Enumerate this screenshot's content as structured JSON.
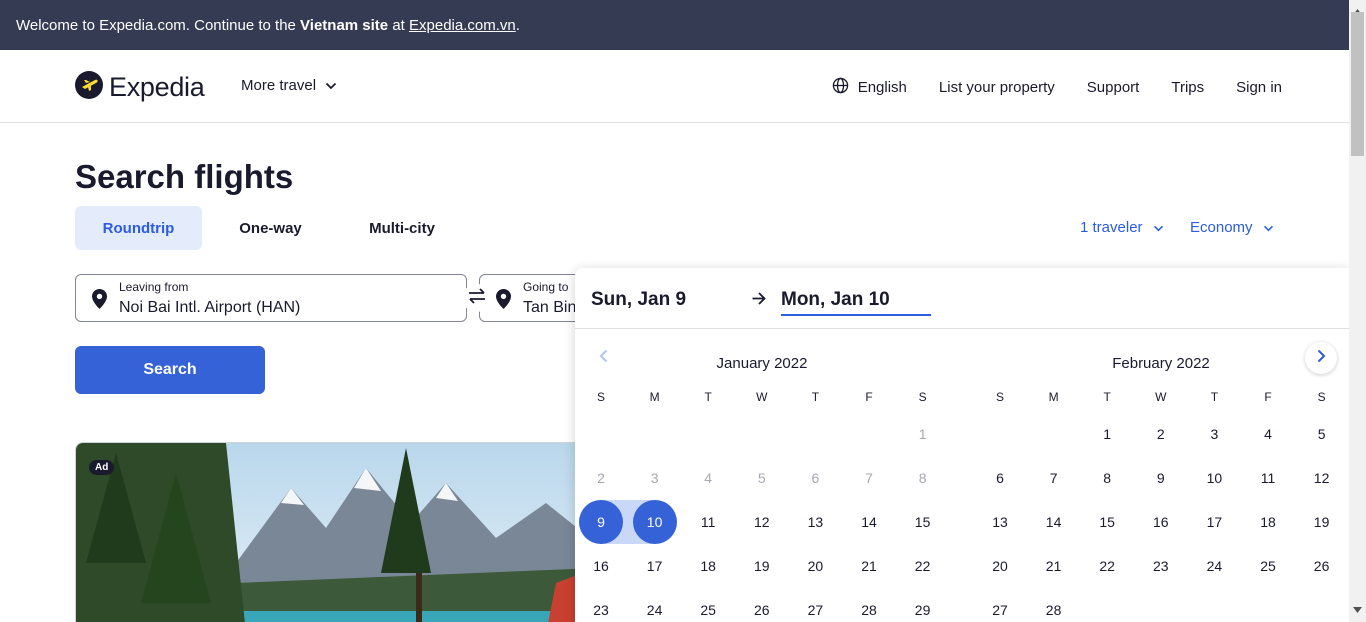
{
  "banner": {
    "text_before": "Welcome to Expedia.com. Continue to the ",
    "site": "Vietnam site",
    "text_middle": " at ",
    "link": "Expedia.com.vn",
    "text_after": "."
  },
  "header": {
    "logo_text": "Expedia",
    "more_travel": "More travel",
    "language": "English",
    "list_property": "List your property",
    "support": "Support",
    "trips": "Trips",
    "sign_in": "Sign in"
  },
  "search": {
    "title": "Search flights",
    "tabs": [
      "Roundtrip",
      "One-way",
      "Multi-city"
    ],
    "travelers": "1 traveler",
    "cabin": "Economy",
    "leaving_label": "Leaving from",
    "leaving_value": "Noi Bai Intl. Airport (HAN)",
    "going_label": "Going to",
    "going_value": "Tan Bin",
    "search_button": "Search"
  },
  "promo": {
    "ad_badge": "Ad"
  },
  "datepicker": {
    "start_date": "Sun, Jan 9",
    "end_date": "Mon, Jan 10",
    "weekdays": [
      "S",
      "M",
      "T",
      "W",
      "T",
      "F",
      "S"
    ],
    "months": [
      {
        "title": "January 2022",
        "weeks": [
          [
            "",
            "",
            "",
            "",
            "",
            "",
            "1"
          ],
          [
            "2",
            "3",
            "4",
            "5",
            "6",
            "7",
            "8"
          ],
          [
            "9",
            "10",
            "11",
            "12",
            "13",
            "14",
            "15"
          ],
          [
            "16",
            "17",
            "18",
            "19",
            "20",
            "21",
            "22"
          ],
          [
            "23",
            "24",
            "25",
            "26",
            "27",
            "28",
            "29"
          ]
        ],
        "past_days": [
          "1",
          "2",
          "3",
          "4",
          "5",
          "6",
          "7",
          "8"
        ],
        "selected_days": [
          "9",
          "10"
        ]
      },
      {
        "title": "February 2022",
        "weeks": [
          [
            "",
            "",
            "1",
            "2",
            "3",
            "4",
            "5"
          ],
          [
            "6",
            "7",
            "8",
            "9",
            "10",
            "11",
            "12"
          ],
          [
            "13",
            "14",
            "15",
            "16",
            "17",
            "18",
            "19"
          ],
          [
            "20",
            "21",
            "22",
            "23",
            "24",
            "25",
            "26"
          ],
          [
            "27",
            "28",
            "",
            "",
            "",
            "",
            ""
          ]
        ],
        "past_days": [],
        "selected_days": []
      }
    ]
  },
  "colors": {
    "banner_bg": "#343b53",
    "accent": "#2b5ce1",
    "button": "#3662d8",
    "selected_range": "#c9d8f7"
  }
}
